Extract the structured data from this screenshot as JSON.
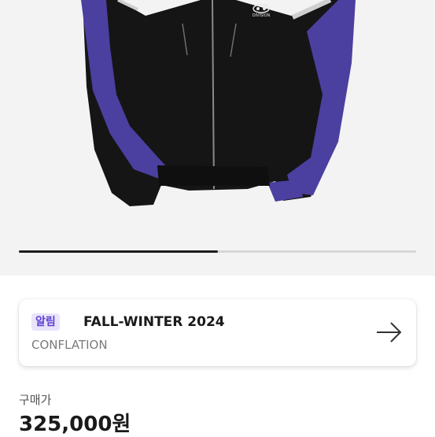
{
  "gallery": {
    "image_alt": "black and purple track jacket",
    "logo_text": "DIVISION",
    "progress": 0.5
  },
  "notice": {
    "badge": "알림",
    "title": "FALL-WINTER 2024",
    "subtitle": "CONFLATION",
    "icon": "arrow-right-icon"
  },
  "price": {
    "label": "구매가",
    "value": "325,000원"
  }
}
